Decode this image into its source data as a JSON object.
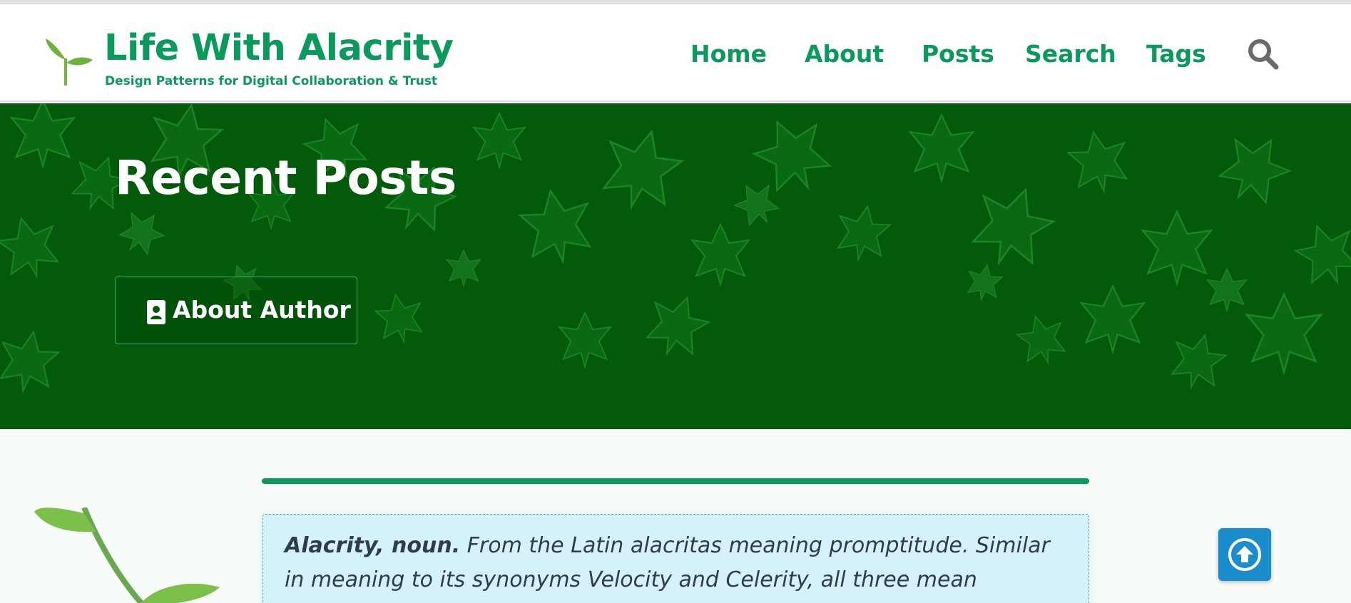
{
  "site": {
    "title": "Life With Alacrity",
    "tagline": "Design Patterns for Digital Collaboration & Trust",
    "logo_icon": "sprout-icon"
  },
  "nav": {
    "items": [
      {
        "label": "Home"
      },
      {
        "label": "About"
      },
      {
        "label": "Posts"
      },
      {
        "label": "Search"
      },
      {
        "label": "Tags"
      }
    ],
    "search_icon": "magnifier-icon"
  },
  "hero": {
    "title": "Recent Posts",
    "about_button": {
      "label": "About Author",
      "icon": "contact-card-icon"
    }
  },
  "definition": {
    "term": "Alacrity, noun.",
    "body": "From the Latin alacritas meaning promptitude. Similar in meaning to its synonyms Velocity and Celerity, all three mean quickness in"
  },
  "scroll_top": {
    "icon": "arrow-up-circle-icon"
  },
  "colors": {
    "brand_green": "#0a9a5b",
    "hero_bg": "#035a0b",
    "definition_bg": "#d5f1fb",
    "scroll_button": "#1b8ccc",
    "search_icon": "#6b6b6b"
  }
}
